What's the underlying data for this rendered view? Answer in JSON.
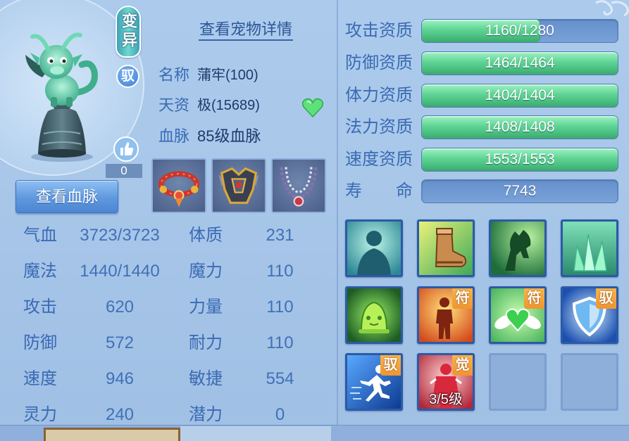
{
  "header": {
    "details_link": "查看宠物详情"
  },
  "pet": {
    "portrait_icon": "pulao-dragon-on-bell",
    "mutation_badge": "变异",
    "ride_badge": "驭",
    "like_icon": "thumbs-up-icon",
    "likes_count": "0",
    "name": {
      "label": "名称",
      "value": "蒲牢(100)"
    },
    "aptitude": {
      "label": "天资",
      "value": "极(15689)"
    },
    "bloodline": {
      "label": "血脉",
      "value": "85级血脉"
    },
    "favorite_icon": "green-heart-icon",
    "view_bloodline_button": "查看血脉"
  },
  "equipment": [
    {
      "icon": "bracelet-icon"
    },
    {
      "icon": "armor-icon"
    },
    {
      "icon": "necklace-icon"
    }
  ],
  "stats": {
    "combat": [
      {
        "label": "气血",
        "value": "3723/3723"
      },
      {
        "label": "魔法",
        "value": "1440/1440"
      },
      {
        "label": "攻击",
        "value": "620"
      },
      {
        "label": "防御",
        "value": "572"
      },
      {
        "label": "速度",
        "value": "946"
      },
      {
        "label": "灵力",
        "value": "240"
      }
    ],
    "attributes": [
      {
        "label": "体质",
        "value": "231"
      },
      {
        "label": "魔力",
        "value": "110"
      },
      {
        "label": "力量",
        "value": "110"
      },
      {
        "label": "耐力",
        "value": "110"
      },
      {
        "label": "敏捷",
        "value": "554"
      },
      {
        "label": "潜力",
        "value": "0"
      }
    ]
  },
  "aptitudes": [
    {
      "label": "攻击资质",
      "text": "1160/1280",
      "fill": 0.6
    },
    {
      "label": "防御资质",
      "text": "1464/1464",
      "fill": 1
    },
    {
      "label": "体力资质",
      "text": "1404/1404",
      "fill": 1
    },
    {
      "label": "法力资质",
      "text": "1408/1408",
      "fill": 1
    },
    {
      "label": "速度资质",
      "text": "1553/1553",
      "fill": 1
    }
  ],
  "lifespan": {
    "label": "寿命",
    "value": "7743",
    "fill": 0
  },
  "skills": [
    {
      "icon": "spirit-silhouette-icon"
    },
    {
      "icon": "boot-icon"
    },
    {
      "icon": "green-horse-icon"
    },
    {
      "icon": "crystal-icon"
    },
    {
      "icon": "bell-icon"
    },
    {
      "icon": "orange-figure-icon",
      "badge": "符"
    },
    {
      "icon": "winged-heart-icon",
      "badge": "符"
    },
    {
      "icon": "shield-icon",
      "badge": "驭"
    },
    {
      "icon": "running-figure-icon",
      "badge": "驭"
    },
    {
      "icon": "red-warrior-icon",
      "badge": "觉",
      "level": "3/5级"
    },
    {
      "icon": "empty-slot"
    },
    {
      "icon": "empty-slot"
    }
  ],
  "colors": {
    "panel_bg": "#a8c7e9",
    "label": "#3a6ab4",
    "value": "#3f71b8",
    "dark_text": "#1e3a6b",
    "bar_fill": "#4cc383",
    "bar_track": "#7aa2d8",
    "badge": "#ef9530"
  }
}
